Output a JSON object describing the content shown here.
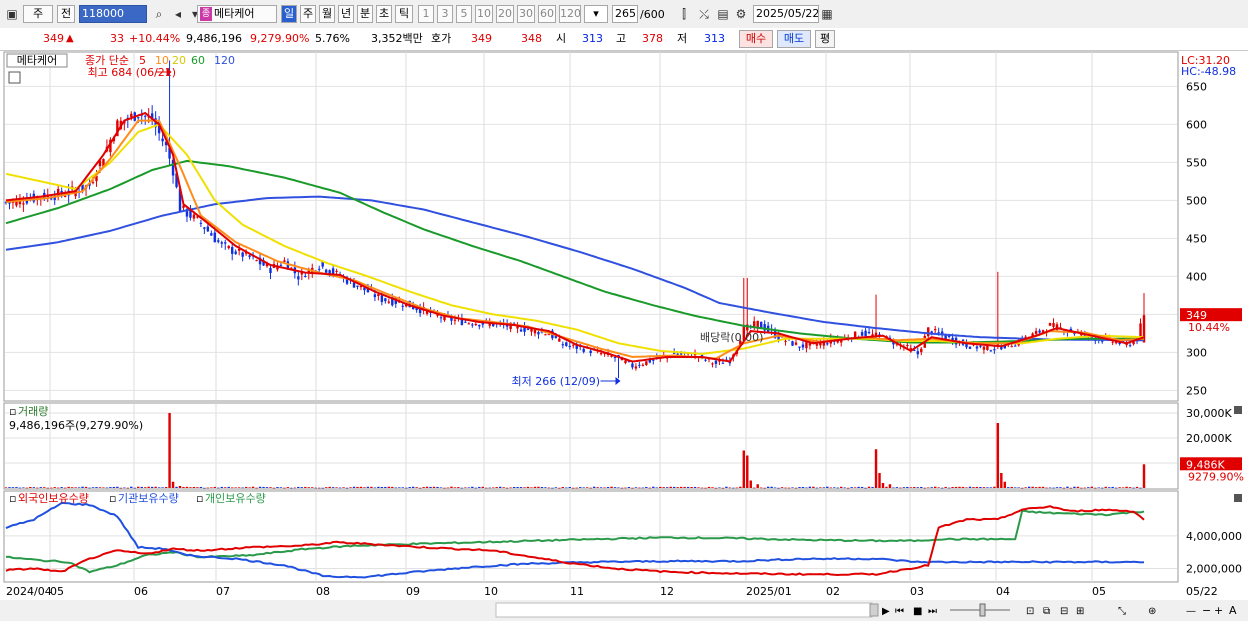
{
  "toolbar": {
    "mode": "주",
    "period_prefix": "전",
    "code": "118000",
    "stock_name": "메타케어",
    "intervals": [
      "일",
      "주",
      "월",
      "년",
      "분",
      "초",
      "틱"
    ],
    "active_interval": "일",
    "counts": [
      "1",
      "3",
      "5",
      "10",
      "20",
      "30",
      "60",
      "120"
    ],
    "view_count": "265",
    "view_total": "/600",
    "date": "2025/05/22"
  },
  "quote": {
    "price": "349",
    "change": "33",
    "change_pct": "+10.44%",
    "volume": "9,486,196",
    "volume_pct": "9,279.90%",
    "turnover": "5.76%",
    "amount": "3,352백만",
    "ask_label": "호가",
    "ask1": "349",
    "ask2": "348",
    "open_label": "시",
    "open": "313",
    "high_label": "고",
    "high": "378",
    "low_label": "저",
    "low": "313",
    "buy_label": "매수",
    "sell_label": "매도",
    "avg_label": "평"
  },
  "colors": {
    "ma5": "#e00000",
    "ma10": "#ff8c1a",
    "ma20": "#f0e000",
    "ma60": "#1a9a2a",
    "ma120": "#3050e0",
    "up": "#e00000",
    "down": "#1030e0"
  },
  "chart_data": [
    {
      "type": "candlestick",
      "title": "메타케어",
      "legend_label": "종가 단순",
      "ma_periods": [
        "5",
        "10",
        "20",
        "60",
        "120"
      ],
      "lc": "LC:31.20",
      "hc": "HC:-48.98",
      "ylim": [
        240,
        690
      ],
      "yticks": [
        250,
        300,
        350,
        400,
        450,
        500,
        550,
        600,
        650
      ],
      "last_price": "349",
      "last_pct": "10.44%",
      "high_note": "최고 684 (06/21)",
      "low_note": "최저 266 (12/09)",
      "dividend_note": "배당락(0.00)",
      "x_labels": [
        "2024/04",
        "05",
        "06",
        "07",
        "08",
        "09",
        "10",
        "11",
        "12",
        "2025/01",
        "02",
        "03",
        "04",
        "05"
      ],
      "right_date": "05/22",
      "x_anchors": [
        [
          0,
          497
        ],
        [
          10,
          505
        ],
        [
          18,
          510
        ],
        [
          24,
          520
        ],
        [
          28,
          560
        ],
        [
          32,
          600
        ],
        [
          38,
          615
        ],
        [
          42,
          605
        ],
        [
          46,
          570
        ],
        [
          48,
          540
        ],
        [
          50,
          490
        ],
        [
          56,
          470
        ],
        [
          62,
          440
        ],
        [
          70,
          425
        ],
        [
          76,
          410
        ],
        [
          80,
          420
        ],
        [
          84,
          400
        ],
        [
          90,
          415
        ],
        [
          96,
          400
        ],
        [
          102,
          385
        ],
        [
          108,
          370
        ],
        [
          114,
          365
        ],
        [
          120,
          355
        ],
        [
          126,
          345
        ],
        [
          132,
          340
        ],
        [
          138,
          338
        ],
        [
          144,
          335
        ],
        [
          150,
          330
        ],
        [
          156,
          325
        ],
        [
          160,
          310
        ],
        [
          166,
          305
        ],
        [
          170,
          300
        ],
        [
          176,
          292
        ],
        [
          180,
          282
        ],
        [
          186,
          290
        ],
        [
          192,
          298
        ],
        [
          198,
          296
        ],
        [
          204,
          285
        ],
        [
          208,
          290
        ],
        [
          212,
          330
        ],
        [
          216,
          338
        ],
        [
          222,
          320
        ],
        [
          228,
          308
        ],
        [
          234,
          312
        ],
        [
          240,
          318
        ],
        [
          246,
          325
        ],
        [
          252,
          320
        ],
        [
          258,
          308
        ],
        [
          262,
          298
        ],
        [
          265,
          330
        ],
        [
          270,
          320
        ],
        [
          276,
          310
        ],
        [
          282,
          305
        ],
        [
          290,
          312
        ],
        [
          296,
          325
        ],
        [
          300,
          335
        ],
        [
          306,
          328
        ],
        [
          312,
          320
        ],
        [
          318,
          315
        ],
        [
          322,
          310
        ],
        [
          325,
          318
        ],
        [
          327,
          349
        ]
      ],
      "ma5_anchors": [
        [
          0,
          500
        ],
        [
          10,
          505
        ],
        [
          20,
          512
        ],
        [
          28,
          560
        ],
        [
          34,
          605
        ],
        [
          40,
          615
        ],
        [
          44,
          600
        ],
        [
          48,
          560
        ],
        [
          51,
          495
        ],
        [
          58,
          470
        ],
        [
          66,
          440
        ],
        [
          76,
          415
        ],
        [
          86,
          405
        ],
        [
          96,
          402
        ],
        [
          106,
          380
        ],
        [
          116,
          362
        ],
        [
          126,
          348
        ],
        [
          136,
          340
        ],
        [
          146,
          336
        ],
        [
          156,
          328
        ],
        [
          164,
          310
        ],
        [
          172,
          300
        ],
        [
          180,
          288
        ],
        [
          190,
          294
        ],
        [
          200,
          294
        ],
        [
          208,
          288
        ],
        [
          214,
          328
        ],
        [
          222,
          325
        ],
        [
          232,
          312
        ],
        [
          242,
          318
        ],
        [
          252,
          322
        ],
        [
          260,
          302
        ],
        [
          266,
          320
        ],
        [
          276,
          312
        ],
        [
          286,
          308
        ],
        [
          296,
          322
        ],
        [
          302,
          332
        ],
        [
          312,
          322
        ],
        [
          322,
          312
        ],
        [
          327,
          320
        ]
      ],
      "ma10_anchors": [
        [
          0,
          498
        ],
        [
          12,
          503
        ],
        [
          22,
          512
        ],
        [
          30,
          555
        ],
        [
          38,
          605
        ],
        [
          44,
          605
        ],
        [
          50,
          545
        ],
        [
          56,
          480
        ],
        [
          66,
          445
        ],
        [
          78,
          420
        ],
        [
          90,
          405
        ],
        [
          100,
          395
        ],
        [
          110,
          376
        ],
        [
          120,
          358
        ],
        [
          130,
          345
        ],
        [
          140,
          340
        ],
        [
          150,
          334
        ],
        [
          160,
          320
        ],
        [
          170,
          306
        ],
        [
          180,
          294
        ],
        [
          192,
          296
        ],
        [
          204,
          292
        ],
        [
          212,
          312
        ],
        [
          222,
          322
        ],
        [
          234,
          314
        ],
        [
          246,
          320
        ],
        [
          256,
          316
        ],
        [
          266,
          318
        ],
        [
          278,
          312
        ],
        [
          290,
          312
        ],
        [
          300,
          328
        ],
        [
          310,
          326
        ],
        [
          320,
          316
        ],
        [
          327,
          318
        ]
      ],
      "ma20_anchors": [
        [
          0,
          535
        ],
        [
          10,
          525
        ],
        [
          20,
          515
        ],
        [
          30,
          550
        ],
        [
          38,
          590
        ],
        [
          44,
          600
        ],
        [
          52,
          560
        ],
        [
          60,
          500
        ],
        [
          68,
          468
        ],
        [
          80,
          440
        ],
        [
          92,
          418
        ],
        [
          104,
          400
        ],
        [
          116,
          380
        ],
        [
          128,
          362
        ],
        [
          140,
          350
        ],
        [
          152,
          342
        ],
        [
          164,
          330
        ],
        [
          176,
          312
        ],
        [
          188,
          302
        ],
        [
          200,
          298
        ],
        [
          212,
          305
        ],
        [
          224,
          318
        ],
        [
          236,
          318
        ],
        [
          248,
          318
        ],
        [
          258,
          315
        ],
        [
          268,
          315
        ],
        [
          280,
          312
        ],
        [
          292,
          312
        ],
        [
          302,
          318
        ],
        [
          314,
          322
        ],
        [
          327,
          320
        ]
      ],
      "ma60_anchors": [
        [
          0,
          470
        ],
        [
          15,
          490
        ],
        [
          30,
          515
        ],
        [
          42,
          540
        ],
        [
          52,
          552
        ],
        [
          64,
          545
        ],
        [
          80,
          530
        ],
        [
          96,
          510
        ],
        [
          108,
          485
        ],
        [
          120,
          462
        ],
        [
          134,
          440
        ],
        [
          148,
          420
        ],
        [
          160,
          400
        ],
        [
          172,
          380
        ],
        [
          186,
          362
        ],
        [
          198,
          348
        ],
        [
          212,
          335
        ],
        [
          228,
          325
        ],
        [
          244,
          318
        ],
        [
          260,
          313
        ],
        [
          276,
          313
        ],
        [
          292,
          315
        ],
        [
          308,
          318
        ],
        [
          327,
          318
        ]
      ],
      "ma120_anchors": [
        [
          0,
          435
        ],
        [
          15,
          445
        ],
        [
          30,
          460
        ],
        [
          45,
          480
        ],
        [
          60,
          495
        ],
        [
          75,
          503
        ],
        [
          90,
          505
        ],
        [
          105,
          500
        ],
        [
          120,
          488
        ],
        [
          135,
          470
        ],
        [
          150,
          452
        ],
        [
          165,
          432
        ],
        [
          180,
          410
        ],
        [
          195,
          385
        ],
        [
          205,
          365
        ],
        [
          220,
          352
        ],
        [
          235,
          340
        ],
        [
          250,
          332
        ],
        [
          265,
          325
        ],
        [
          280,
          320
        ],
        [
          300,
          317
        ],
        [
          327,
          316
        ]
      ]
    },
    {
      "type": "bar",
      "title": "거래량",
      "readout": "9,486,196주(9,279.90%)",
      "ylim": [
        0,
        32000000
      ],
      "yticks": [
        "30,000K",
        "20,000K",
        "10,000K"
      ],
      "yticks_values": [
        30000000,
        20000000,
        10000000
      ],
      "last_value": "9,486K",
      "last_pct": "9279.90%",
      "spikes": [
        [
          47,
          30000000
        ],
        [
          48,
          2500000
        ],
        [
          50,
          800000
        ],
        [
          191,
          500000
        ],
        [
          212,
          15000000
        ],
        [
          213,
          13000000
        ],
        [
          214,
          3000000
        ],
        [
          216,
          1500000
        ],
        [
          250,
          15500000
        ],
        [
          251,
          6000000
        ],
        [
          252,
          2000000
        ],
        [
          254,
          1500000
        ],
        [
          285,
          26000000
        ],
        [
          286,
          6000000
        ],
        [
          287,
          2500000
        ],
        [
          327,
          9486196
        ]
      ]
    },
    {
      "type": "line",
      "series": [
        {
          "name": "외국인보유수량",
          "color": "#e00000"
        },
        {
          "name": "기관보유수량",
          "color": "#2050e0"
        },
        {
          "name": "개인보유수량",
          "color": "#2a9a4a"
        }
      ],
      "ylim": [
        1300000,
        6500000
      ],
      "yticks": [
        "4,000,000",
        "2,000,000"
      ],
      "yticks_values": [
        4000000,
        2000000
      ],
      "foreign_anchors": [
        [
          0,
          1900000
        ],
        [
          8,
          2000000
        ],
        [
          16,
          1800000
        ],
        [
          24,
          2600000
        ],
        [
          32,
          3100000
        ],
        [
          40,
          2900000
        ],
        [
          48,
          3200000
        ],
        [
          56,
          3100000
        ],
        [
          70,
          3300000
        ],
        [
          85,
          3400000
        ],
        [
          95,
          3600000
        ],
        [
          105,
          3500000
        ],
        [
          120,
          3300000
        ],
        [
          140,
          3100000
        ],
        [
          160,
          2400000
        ],
        [
          175,
          2000000
        ],
        [
          190,
          1800000
        ],
        [
          210,
          1700000
        ],
        [
          230,
          1650000
        ],
        [
          250,
          1650000
        ],
        [
          265,
          2200000
        ],
        [
          268,
          4500000
        ],
        [
          276,
          5000000
        ],
        [
          285,
          5000000
        ],
        [
          292,
          5600000
        ],
        [
          300,
          5800000
        ],
        [
          306,
          5500000
        ],
        [
          316,
          5600000
        ],
        [
          324,
          5500000
        ],
        [
          327,
          5000000
        ]
      ],
      "institution_anchors": [
        [
          0,
          4500000
        ],
        [
          8,
          5000000
        ],
        [
          16,
          6000000
        ],
        [
          24,
          5900000
        ],
        [
          32,
          5200000
        ],
        [
          38,
          3300000
        ],
        [
          46,
          3200000
        ],
        [
          52,
          2800000
        ],
        [
          66,
          2600000
        ],
        [
          80,
          2200000
        ],
        [
          92,
          1500000
        ],
        [
          104,
          1500000
        ],
        [
          118,
          1800000
        ],
        [
          134,
          2100000
        ],
        [
          150,
          2300000
        ],
        [
          170,
          2400000
        ],
        [
          190,
          2450000
        ],
        [
          210,
          2450000
        ],
        [
          230,
          2600000
        ],
        [
          250,
          2600000
        ],
        [
          262,
          2400000
        ],
        [
          280,
          2400000
        ],
        [
          300,
          2400000
        ],
        [
          327,
          2400000
        ]
      ],
      "individual_anchors": [
        [
          0,
          2700000
        ],
        [
          10,
          2500000
        ],
        [
          18,
          2400000
        ],
        [
          24,
          1800000
        ],
        [
          32,
          2200000
        ],
        [
          40,
          2800000
        ],
        [
          48,
          3000000
        ],
        [
          56,
          2700000
        ],
        [
          70,
          2800000
        ],
        [
          86,
          3200000
        ],
        [
          100,
          3400000
        ],
        [
          116,
          3500000
        ],
        [
          134,
          3600000
        ],
        [
          152,
          3700000
        ],
        [
          170,
          3800000
        ],
        [
          190,
          3900000
        ],
        [
          210,
          3850000
        ],
        [
          230,
          3750000
        ],
        [
          250,
          3700000
        ],
        [
          262,
          3700000
        ],
        [
          268,
          3800000
        ],
        [
          280,
          3800000
        ],
        [
          290,
          3800000
        ],
        [
          292,
          5500000
        ],
        [
          300,
          5400000
        ],
        [
          316,
          5300000
        ],
        [
          327,
          5500000
        ]
      ]
    }
  ]
}
